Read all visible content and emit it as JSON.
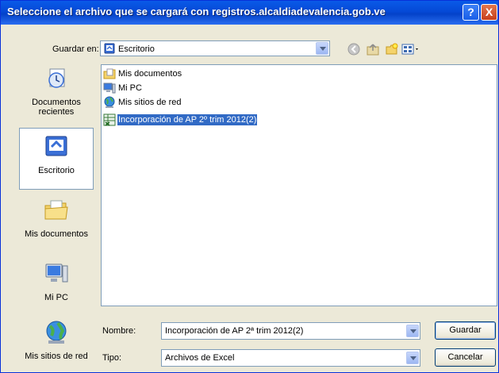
{
  "window": {
    "title": "Seleccione el archivo que se cargará con registros.alcaldiadevalencia.gob.ve",
    "help_label": "?",
    "close_label": "X"
  },
  "look_in": {
    "label": "Guardar en:",
    "value": "Escritorio",
    "icon": "desktop-icon"
  },
  "toolbar": {
    "back": "back-icon",
    "up": "up-folder-icon",
    "new_folder": "new-folder-icon",
    "views": "views-menu-icon"
  },
  "places": [
    {
      "label": "Documentos recientes",
      "icon": "recent-documents-icon"
    },
    {
      "label": "Escritorio",
      "icon": "desktop-icon",
      "selected": true
    },
    {
      "label": "Mis documentos",
      "icon": "my-documents-icon"
    },
    {
      "label": "Mi PC",
      "icon": "my-computer-icon"
    },
    {
      "label": "Mis sitios de red",
      "icon": "network-places-icon"
    }
  ],
  "files": [
    {
      "name": "Mis documentos",
      "icon": "my-documents-icon"
    },
    {
      "name": "Mi PC",
      "icon": "my-computer-icon"
    },
    {
      "name": "Mis sitios de red",
      "icon": "network-places-icon"
    },
    {
      "name": "Incorporación de AP 2º trim 2012(2)",
      "icon": "excel-file-icon",
      "selected": true
    }
  ],
  "filename": {
    "label": "Nombre:",
    "value": "Incorporación de AP 2ª trim 2012(2)"
  },
  "filetype": {
    "label": "Tipo:",
    "value": "Archivos de Excel"
  },
  "buttons": {
    "save": "Guardar",
    "cancel": "Cancelar"
  },
  "colors": {
    "title_bar": "#0549d6",
    "selection": "#316ac5",
    "dialog_bg": "#ece9d8"
  }
}
